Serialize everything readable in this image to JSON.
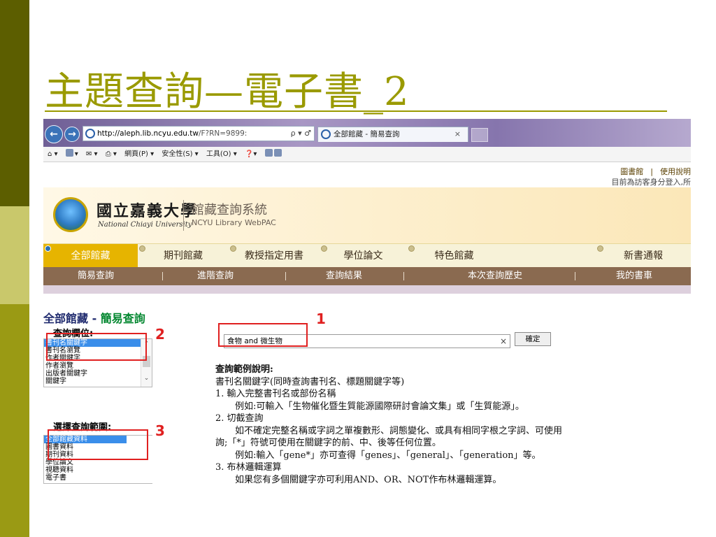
{
  "slide": {
    "title": "主題查詢—電子書_2"
  },
  "browser": {
    "url_host": "http://aleph.lib.ncyu.edu.tw",
    "url_path": "/F?RN=9899:",
    "url_tools": "ρ ▾ ♂",
    "tab_title": "全部館藏 - 簡易查詢",
    "tab_close": "×",
    "back_icon": "arrow-left-icon",
    "forward_icon": "arrow-right-icon"
  },
  "command_bar": {
    "items": [
      "網頁(P) ▾",
      "安全性(S) ▾",
      "工具(O) ▾"
    ]
  },
  "header": {
    "links": [
      "圖書館",
      "使用說明"
    ],
    "login_msg": "目前為訪客身分登入,所"
  },
  "banner": {
    "university_zh": "國立嘉義大學",
    "university_en": "National Chiayi University",
    "system_zh": "館藏查詢系統",
    "system_en": "NCYU Library WebPAC"
  },
  "tabs": [
    "全部館藏",
    "期刊館藏",
    "教授指定用書",
    "學位論文",
    "特色館藏",
    "新書通報"
  ],
  "active_tab": 0,
  "subnav": [
    "簡易查詢",
    "進階查詢",
    "查詢結果",
    "本次查詢歷史",
    "我的書車"
  ],
  "breadcrumb": {
    "main": "全部館藏 - ",
    "sub": "簡易查詢"
  },
  "search": {
    "value": "食物 and 微生物",
    "clear": "×",
    "confirm_label": "確定"
  },
  "field_select": {
    "heading": "查詢欄位:",
    "options": [
      "書刊名關鍵字",
      "書刊名瀏覽",
      "作者關鍵字",
      "作者瀏覽",
      "出版者關鍵字",
      "關鍵字"
    ],
    "selected": 0
  },
  "scope_select": {
    "heading": "選擇查詢範圍:",
    "options": [
      "全部館藏資料",
      "圖書資料",
      "期刊資料",
      "學位論文",
      "視聽資料",
      "電子書"
    ],
    "selected": 0
  },
  "help": {
    "lines": [
      "查詢範例說明:",
      "書刊名關鍵字(同時查詢書刊名、標題關鍵字等)",
      "1. 輸入完整書刊名或部份名稱",
      "例如:可輸入「生物催化暨生質能源國際研討會論文集」或「生質能源」。",
      "2. 切截查詢",
      "如不確定完整名稱或字詞之單複數形、詞態變化、或具有相同字根之字詞、可使用",
      "詢;「*」符號可使用在關鍵字的前、中、後等任何位置。",
      "例如:輸入「gene*」亦可查得「genes」、「general」、「generation」等。",
      "3. 布林邏輯運算",
      "如果您有多個關鍵字亦可利用AND、OR、NOT作布林邏輯運算。"
    ]
  },
  "annotations": [
    "1",
    "2",
    "3"
  ],
  "colors": {
    "title": "#9a9a00",
    "active_tab": "#e6b400",
    "subnav": "#8a6a50",
    "selection": "#3a8eea",
    "annotation_red": "#e02020",
    "breadcrumb_main": "#1f2a6e",
    "breadcrumb_sub": "#00862e"
  }
}
